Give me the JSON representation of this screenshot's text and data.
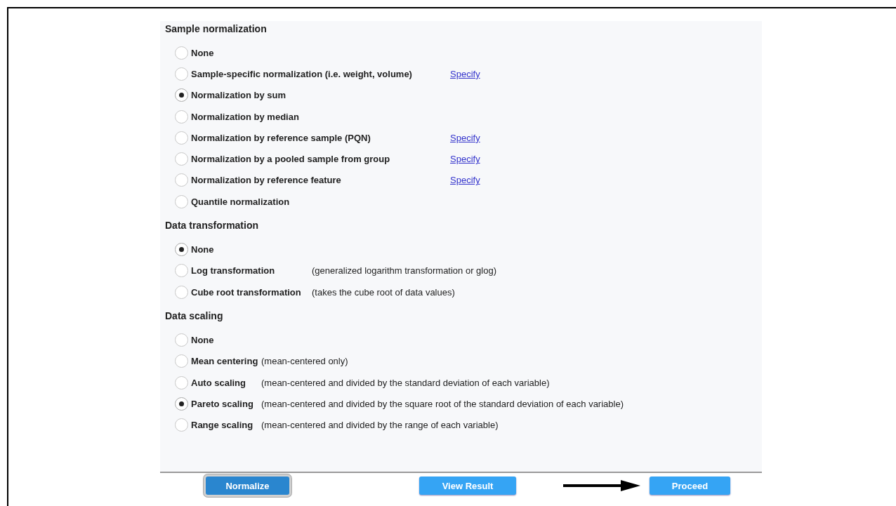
{
  "sections": [
    {
      "title": "Sample normalization",
      "options": [
        {
          "label": "None",
          "selected": false
        },
        {
          "label": "Sample-specific normalization (i.e. weight, volume)",
          "selected": false,
          "link": "Specify"
        },
        {
          "label": "Normalization by sum",
          "selected": true
        },
        {
          "label": "Normalization by median",
          "selected": false
        },
        {
          "label": "Normalization by reference sample (PQN)",
          "selected": false,
          "link": "Specify"
        },
        {
          "label": "Normalization by a pooled sample from group",
          "selected": false,
          "link": "Specify"
        },
        {
          "label": "Normalization by reference feature",
          "selected": false,
          "link": "Specify"
        },
        {
          "label": "Quantile normalization",
          "selected": false
        }
      ]
    },
    {
      "title": "Data transformation",
      "options": [
        {
          "label": "None",
          "selected": true
        },
        {
          "label": "Log transformation",
          "selected": false,
          "note": "(generalized logarithm transformation or glog)"
        },
        {
          "label": "Cube root transformation",
          "selected": false,
          "note": "(takes the cube root of data values)"
        }
      ]
    },
    {
      "title": "Data scaling",
      "options": [
        {
          "label": "None",
          "selected": false
        },
        {
          "label": "Mean centering",
          "selected": false,
          "note": "(mean-centered only)"
        },
        {
          "label": "Auto scaling",
          "selected": false,
          "note": "(mean-centered and divided by the standard deviation of each variable)"
        },
        {
          "label": "Pareto scaling",
          "selected": true,
          "note": "(mean-centered and divided by the square root of the standard deviation of each variable)"
        },
        {
          "label": "Range scaling",
          "selected": false,
          "note": "(mean-centered and divided by the range of each variable)"
        }
      ]
    }
  ],
  "buttons": [
    {
      "label": "Normalize",
      "focused": true
    },
    {
      "label": "View Result",
      "focused": false
    },
    {
      "label": "Proceed",
      "focused": false
    }
  ]
}
